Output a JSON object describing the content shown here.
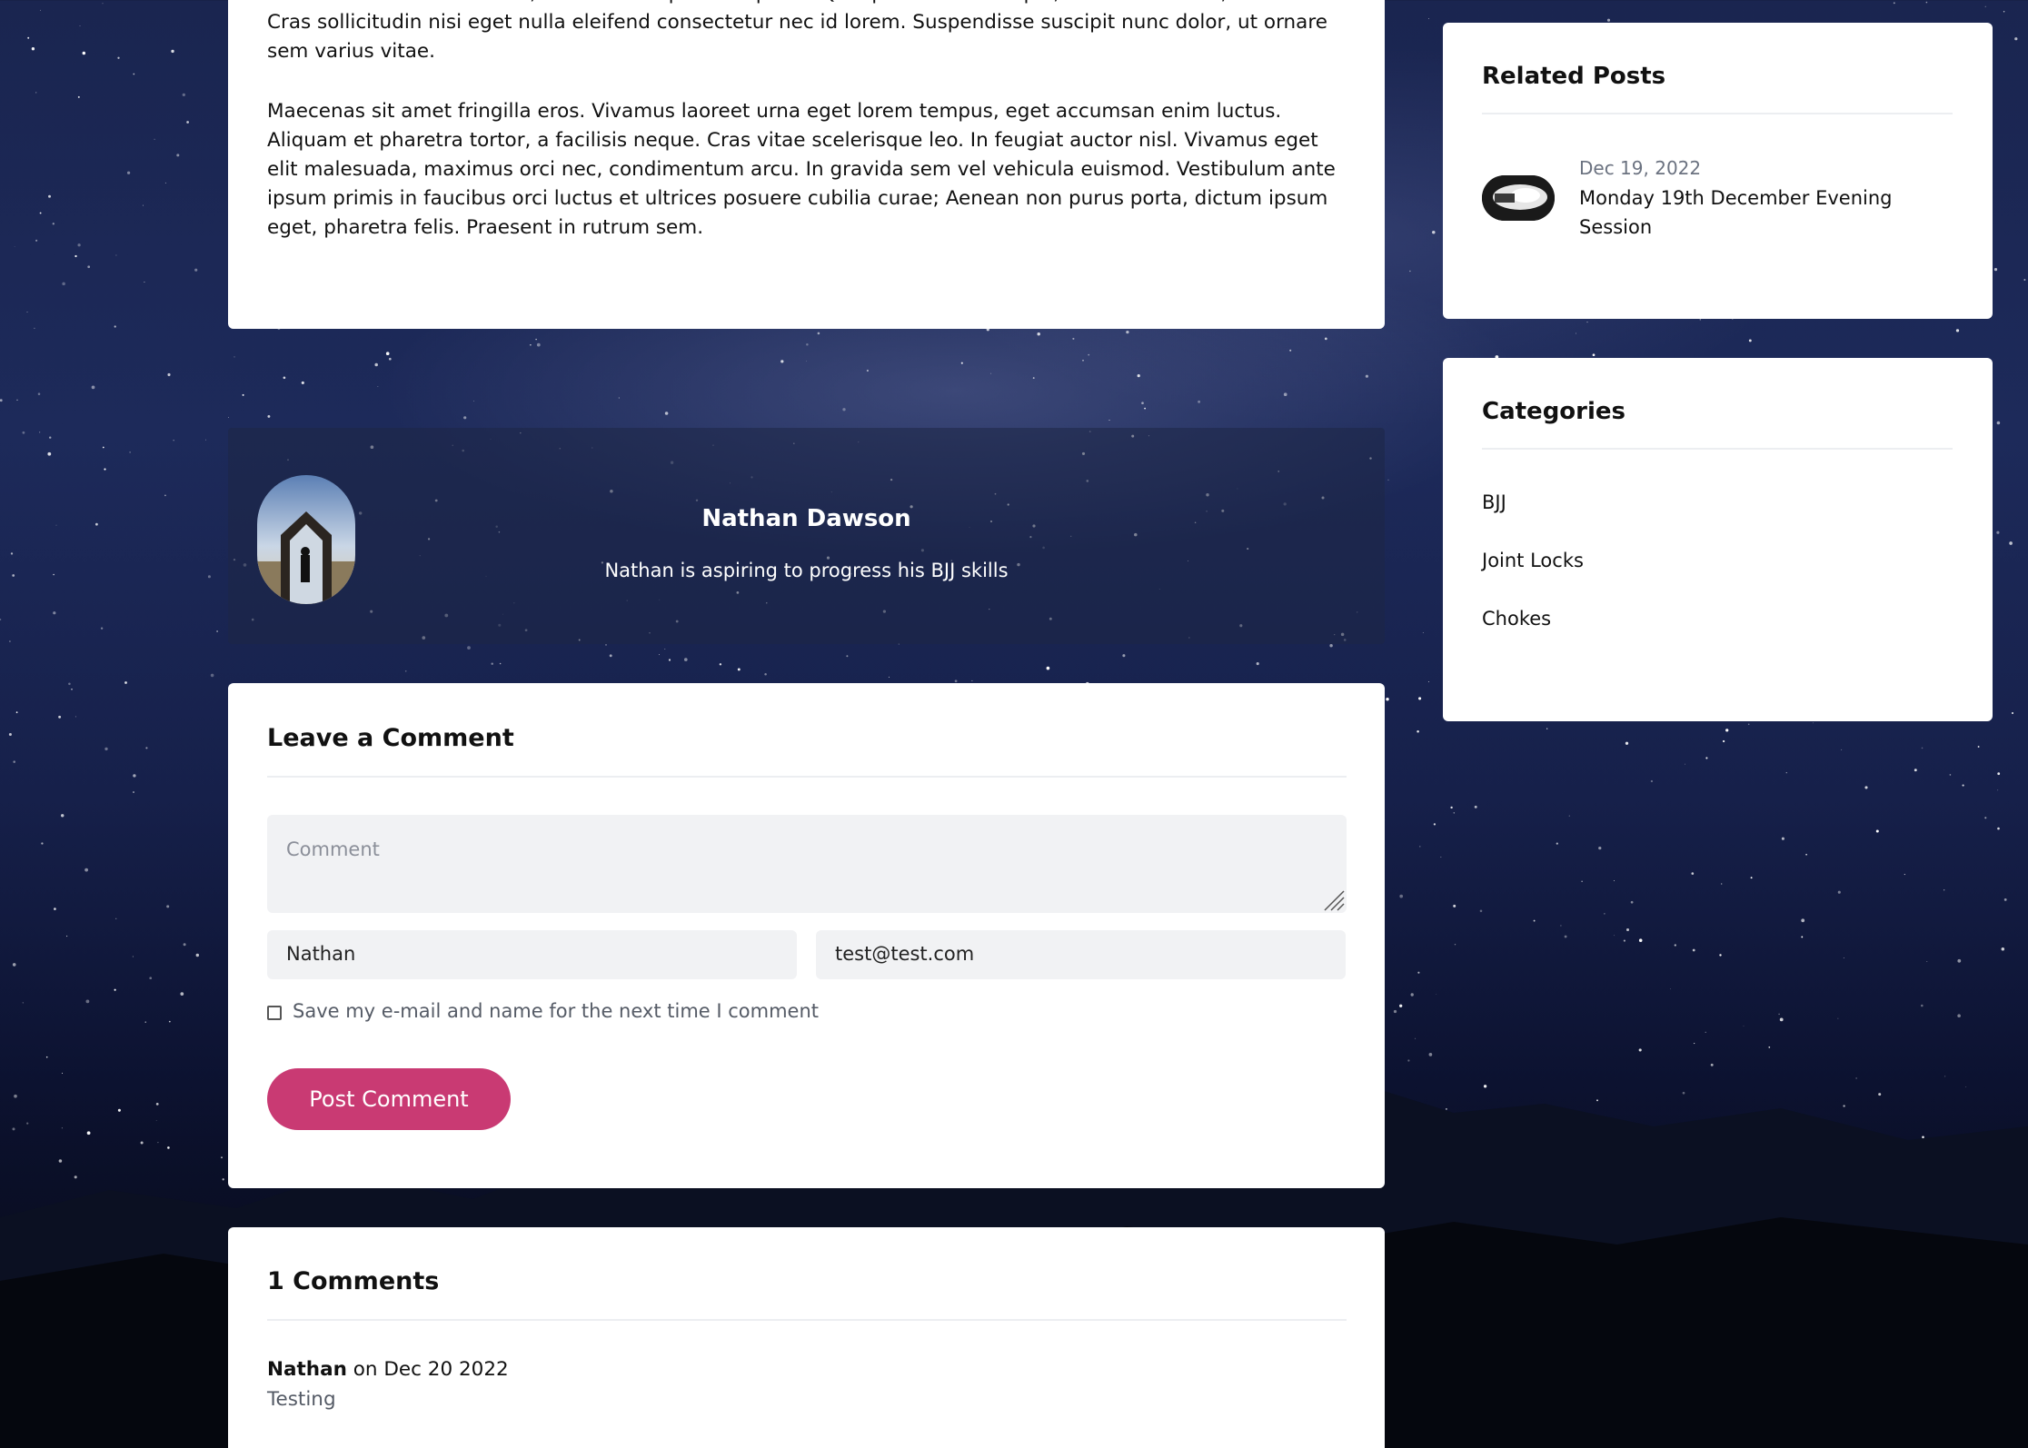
{
  "article": {
    "paragraph_1": "Donec accumsan nibh felis, ac varius neque tristique sit Quisque ac leo tristique, blandit tortor et, ornare leo. Cras sollicitudin nisi eget nulla eleifend consectetur nec id lorem. Suspendisse suscipit nunc dolor, ut ornare sem varius vitae.",
    "paragraph_2": "Maecenas sit amet fringilla eros. Vivamus laoreet urna eget lorem tempus, eget accumsan enim luctus. Aliquam et pharetra tortor, a facilisis neque. Cras vitae scelerisque leo. In feugiat auctor nisl. Vivamus eget elit malesuada, maximus orci nec, condimentum arcu. In gravida sem vel vehicula euismod. Vestibulum ante ipsum primis in faucibus orci luctus et ultrices posuere cubilia curae; Aenean non purus porta, dictum ipsum eget, pharetra felis. Praesent in rutrum sem."
  },
  "author": {
    "name": "Nathan Dawson",
    "bio": "Nathan is aspiring to progress his BJJ skills"
  },
  "comment_form": {
    "title": "Leave a Comment",
    "comment_placeholder": "Comment",
    "name_value": "Nathan",
    "email_value": "test@test.com",
    "save_label": "Save my e-mail and name for the next time I comment",
    "save_checked": false,
    "submit_label": "Post Comment"
  },
  "comments": {
    "title": "1 Comments",
    "items": [
      {
        "author": "Nathan",
        "meta": " on Dec 20 2022",
        "text": "Testing"
      }
    ]
  },
  "sidebar": {
    "related": {
      "title": "Related Posts",
      "items": [
        {
          "date": "Dec 19, 2022",
          "title": "Monday 19th December Evening Session"
        }
      ]
    },
    "categories": {
      "title": "Categories",
      "items": [
        "BJJ",
        "Joint Locks",
        "Chokes"
      ]
    }
  },
  "colors": {
    "accent": "#c93a73",
    "card": "#ffffff",
    "input_bg": "#f1f2f4"
  }
}
